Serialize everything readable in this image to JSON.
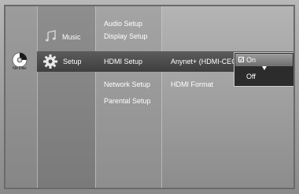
{
  "disc": {
    "label": "No Disc",
    "icon": "disc-icon"
  },
  "main_menu": {
    "items": [
      {
        "label": "Music",
        "icon": "music-note-icon"
      },
      {
        "label": "Setup",
        "icon": "gear-icon",
        "selected": true
      }
    ]
  },
  "setup_menu": {
    "items": [
      {
        "label": "Audio Setup"
      },
      {
        "label": "Display Setup"
      },
      {
        "label": "HDMI Setup",
        "selected": true
      },
      {
        "label": "Network Setup"
      },
      {
        "label": "Parental Setup"
      }
    ]
  },
  "hdmi_menu": {
    "items": [
      {
        "label": "Anynet+ (HDMI-CEC)",
        "selected": true
      },
      {
        "label": "HDMI Format"
      }
    ]
  },
  "anynet_dropdown": {
    "options": [
      {
        "label": "On",
        "checked": true,
        "highlighted": true
      },
      {
        "label": "Off",
        "checked": false
      }
    ]
  },
  "colors": {
    "highlight_bar": "#4a4a4a",
    "text": "#ffffff",
    "dropdown_bg": "#2c2c2c"
  }
}
